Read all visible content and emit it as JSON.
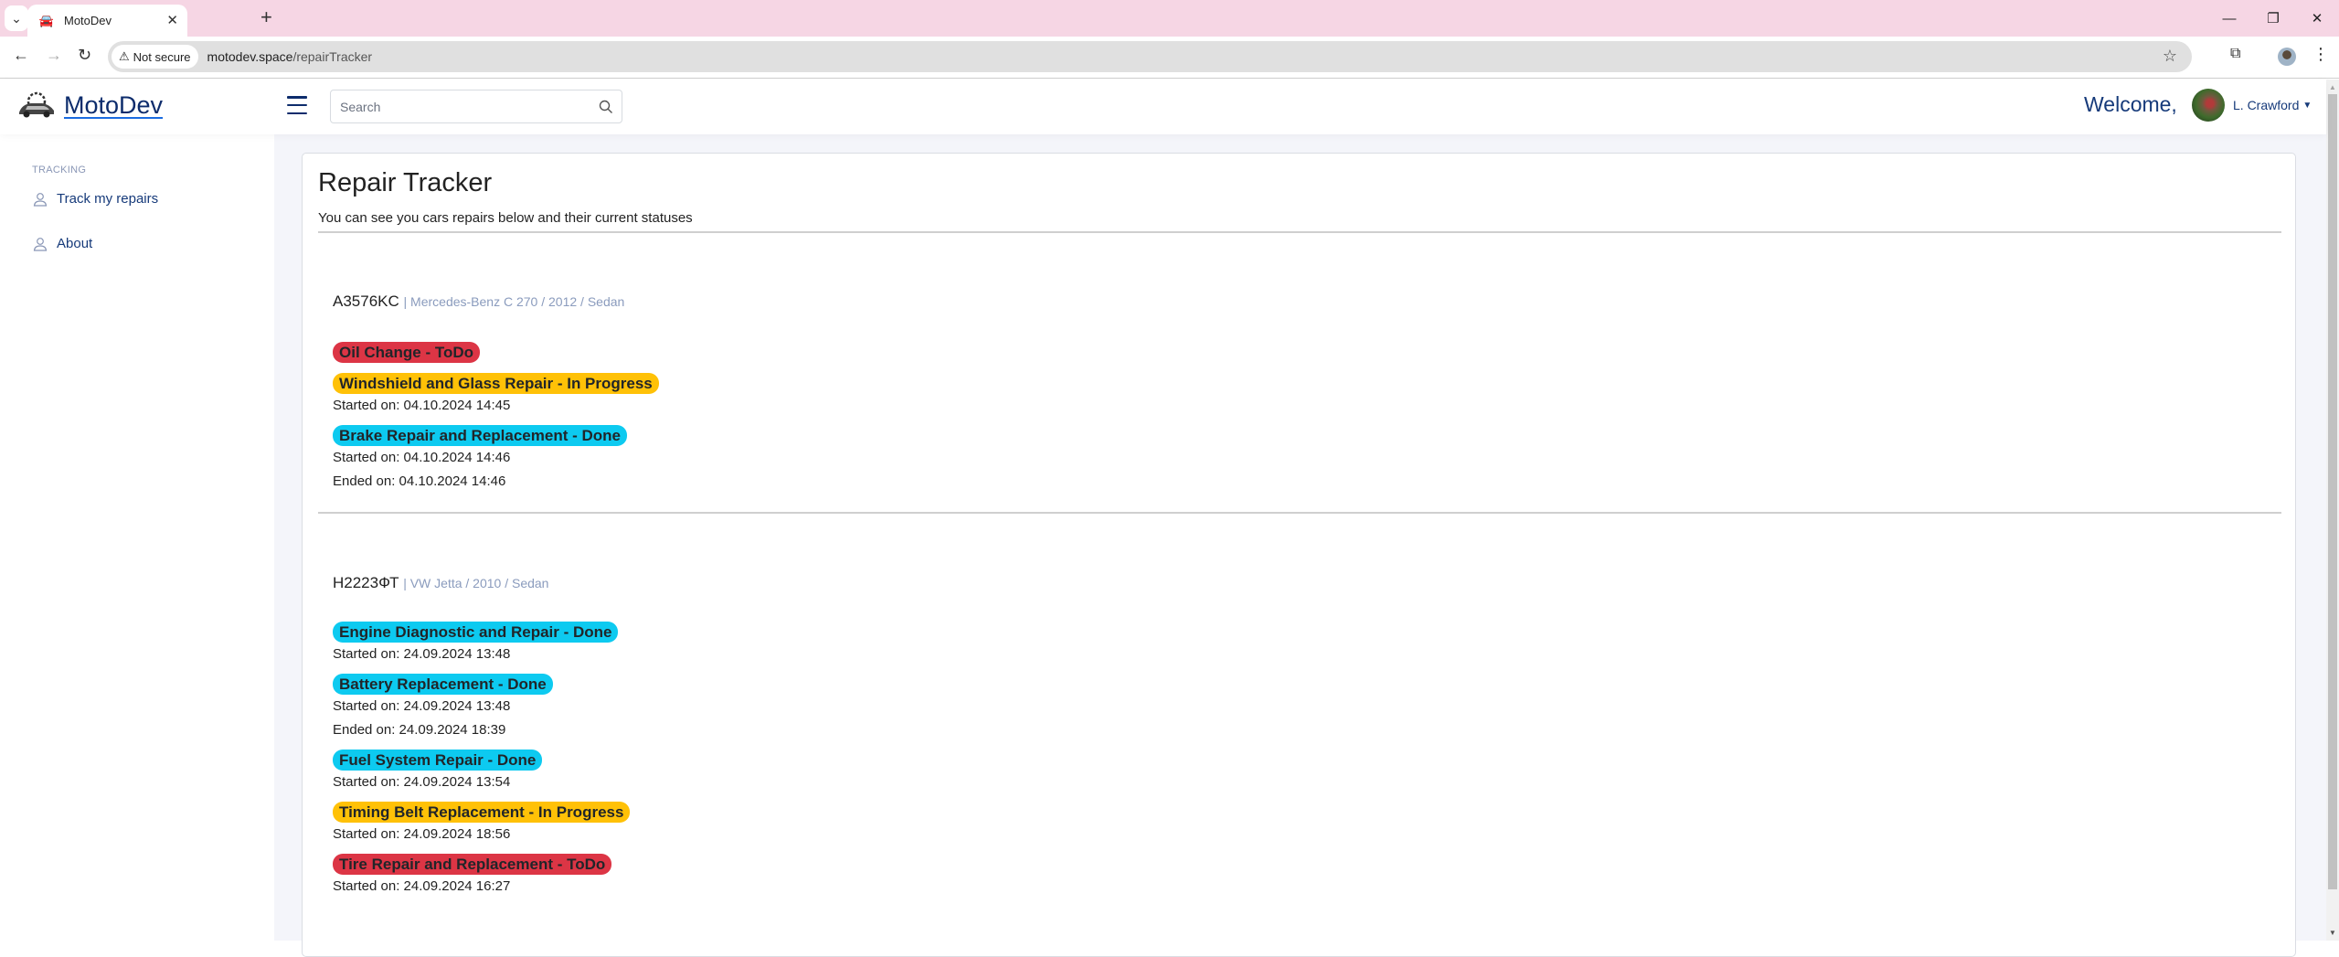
{
  "browser": {
    "tab_title": "MotoDev",
    "url_host": "motodev.space",
    "url_path": "/repairTracker",
    "security_label": "Not secure"
  },
  "header": {
    "brand": "MotoDev",
    "search_placeholder": "Search",
    "welcome": "Welcome,",
    "user_name": "L. Crawford"
  },
  "sidebar": {
    "heading": "TRACKING",
    "items": [
      {
        "label": "Track my repairs",
        "icon": "person-icon"
      },
      {
        "label": "About",
        "icon": "person-icon"
      }
    ]
  },
  "main": {
    "title": "Repair Tracker",
    "subtitle": "You can see you cars repairs below and their current statuses",
    "status_colors": {
      "ToDo": "#dc3545",
      "In Progress": "#ffc107",
      "Done": "#0dcaf0"
    },
    "cars": [
      {
        "plate": "A3576KC",
        "meta": "| Mercedes-Benz C 270 / 2012 / Sedan",
        "repairs": [
          {
            "label": "Oil Change - ToDo",
            "status": "todo",
            "lines": []
          },
          {
            "label": "Windshield and Glass Repair - In Progress",
            "status": "progress",
            "lines": [
              "Started on: 04.10.2024 14:45"
            ]
          },
          {
            "label": "Brake Repair and Replacement - Done",
            "status": "done",
            "lines": [
              "Started on: 04.10.2024 14:46",
              "Ended on: 04.10.2024 14:46"
            ]
          }
        ]
      },
      {
        "plate": "H2223ФТ",
        "meta": "| VW Jetta / 2010 / Sedan",
        "repairs": [
          {
            "label": "Engine Diagnostic and Repair - Done",
            "status": "done",
            "lines": [
              "Started on: 24.09.2024 13:48"
            ]
          },
          {
            "label": "Battery Replacement - Done",
            "status": "done",
            "lines": [
              "Started on: 24.09.2024 13:48",
              "Ended on: 24.09.2024 18:39"
            ]
          },
          {
            "label": "Fuel System Repair - Done",
            "status": "done",
            "lines": [
              "Started on: 24.09.2024 13:54"
            ]
          },
          {
            "label": "Timing Belt Replacement - In Progress",
            "status": "progress",
            "lines": [
              "Started on: 24.09.2024 18:56"
            ]
          },
          {
            "label": "Tire Repair and Replacement - ToDo",
            "status": "todo",
            "lines": [
              "Started on: 24.09.2024 16:27"
            ]
          }
        ]
      }
    ]
  }
}
